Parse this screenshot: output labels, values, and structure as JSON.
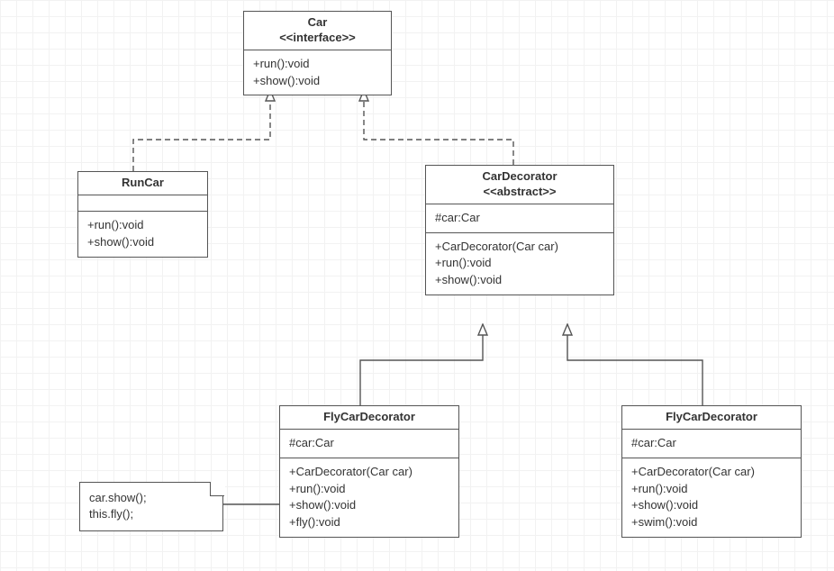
{
  "diagram": {
    "car": {
      "name": "Car",
      "stereotype": "<<interface>>",
      "methods": [
        "+run():void",
        "+show():void"
      ]
    },
    "runcar": {
      "name": "RunCar",
      "methods": [
        "+run():void",
        "+show():void"
      ]
    },
    "cardecorator": {
      "name": "CarDecorator",
      "stereotype": "<<abstract>>",
      "attributes": [
        "#car:Car"
      ],
      "methods": [
        "+CarDecorator(Car car)",
        "+run():void",
        "+show():void"
      ]
    },
    "flycardecorator": {
      "name": "FlyCarDecorator",
      "attributes": [
        "#car:Car"
      ],
      "methods": [
        "+CarDecorator(Car car)",
        "+run():void",
        "+show():void",
        "+fly():void"
      ]
    },
    "swimcardecorator": {
      "name": "FlyCarDecorator",
      "attributes": [
        "#car:Car"
      ],
      "methods": [
        "+CarDecorator(Car car)",
        "+run():void",
        "+show():void",
        "+swim():void"
      ]
    },
    "note": {
      "lines": [
        "car.show();",
        "this.fly();"
      ]
    }
  },
  "chart_data": {
    "type": "uml-class-diagram",
    "classes": [
      {
        "id": "Car",
        "stereotype": "interface",
        "attributes": [],
        "methods": [
          "+run():void",
          "+show():void"
        ]
      },
      {
        "id": "RunCar",
        "stereotype": null,
        "attributes": [],
        "methods": [
          "+run():void",
          "+show():void"
        ]
      },
      {
        "id": "CarDecorator",
        "stereotype": "abstract",
        "attributes": [
          "#car:Car"
        ],
        "methods": [
          "+CarDecorator(Car car)",
          "+run():void",
          "+show():void"
        ]
      },
      {
        "id": "FlyCarDecorator",
        "stereotype": null,
        "attributes": [
          "#car:Car"
        ],
        "methods": [
          "+CarDecorator(Car car)",
          "+run():void",
          "+show():void",
          "+fly():void"
        ]
      },
      {
        "id": "FlyCarDecorator2",
        "display_name": "FlyCarDecorator",
        "stereotype": null,
        "attributes": [
          "#car:Car"
        ],
        "methods": [
          "+CarDecorator(Car car)",
          "+run():void",
          "+show():void",
          "+swim():void"
        ]
      }
    ],
    "relationships": [
      {
        "from": "RunCar",
        "to": "Car",
        "type": "realization"
      },
      {
        "from": "CarDecorator",
        "to": "Car",
        "type": "realization"
      },
      {
        "from": "FlyCarDecorator",
        "to": "CarDecorator",
        "type": "generalization"
      },
      {
        "from": "FlyCarDecorator2",
        "to": "CarDecorator",
        "type": "generalization"
      }
    ],
    "notes": [
      {
        "text": "car.show();\nthis.fly();",
        "attached_to": "FlyCarDecorator"
      }
    ]
  }
}
